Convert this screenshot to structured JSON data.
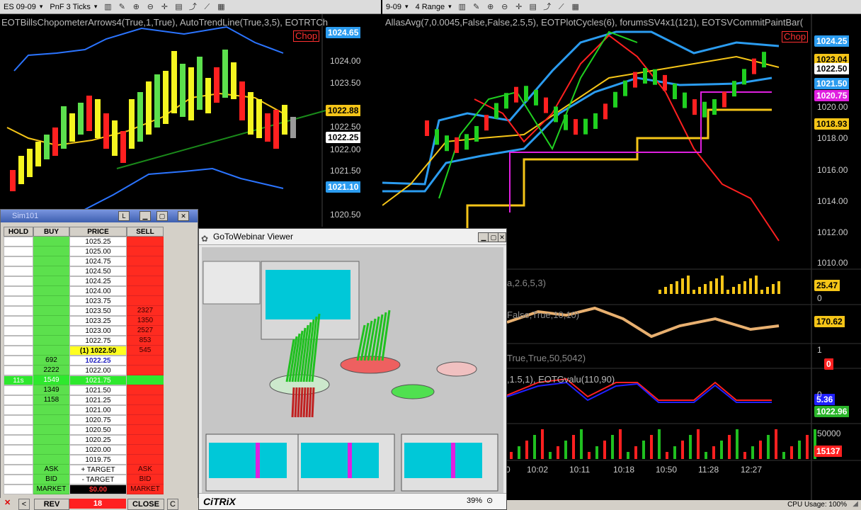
{
  "left_chart": {
    "toolbar": {
      "instrument": "ES 09-09",
      "bar_type": "PnF 3 Ticks"
    },
    "title": "EOTBillsChopometerArrows4(True,1,True), AutoTrendLine(True,3,5), EOTRTCh",
    "chop": "Chop",
    "axis_labels": [
      "1024.00",
      "1023.50",
      "1022.50",
      "1022.00",
      "1021.50",
      "1020.50"
    ],
    "tags": [
      {
        "text": "1024.65",
        "color": "#2b9cf0"
      },
      {
        "text": "1022.88",
        "color": "#f5c518"
      },
      {
        "text": "1022.25",
        "color": "#ffffff"
      },
      {
        "text": "1021.10",
        "color": "#2b9cf0"
      }
    ]
  },
  "right_chart": {
    "toolbar": {
      "instrument": "9-09",
      "bar_type": "4 Range"
    },
    "title": "AllasAvg(7,0.0045,False,False,2.5,5), EOTPlotCycles(6), forumsSV4x1(121), EOTSVCommitPaintBar(",
    "chop": "Chop",
    "axis_labels": [
      "1020.00",
      "1018.00",
      "1016.00",
      "1014.00",
      "1012.00",
      "1010.00"
    ],
    "tags": [
      {
        "text": "1024.25",
        "color": "#2b9cf0"
      },
      {
        "text": "1023.04",
        "color": "#f5c518"
      },
      {
        "text": "1022.50",
        "color": "#ffffff"
      },
      {
        "text": "1021.50",
        "color": "#2b9cf0"
      },
      {
        "text": "1020.75",
        "color": "#e020e0"
      },
      {
        "text": "1018.93",
        "color": "#f5c518"
      }
    ],
    "panels": [
      {
        "title": "a,2.6,5,3)",
        "tag": "25.47",
        "tag_color": "#f5c518",
        "axis": "0"
      },
      {
        "title": "False,True,10,10)",
        "tag": "170.62",
        "tag_color": "#f5c518",
        "axis": ""
      },
      {
        "title": "True,True,50,5042)",
        "tag": "0",
        "tag_color": "#ff2020",
        "axis": "1"
      },
      {
        "title": ",1.5,1), EOTGvalu(110,90)",
        "tag": "5.36",
        "tag_color": "#2020ff",
        "tag2": "1022.96",
        "tag2_color": "#2ab52a",
        "axis": "0"
      },
      {
        "title": "",
        "tag": "15137",
        "tag_color": "#ff2020",
        "axis": "50000"
      }
    ],
    "time_labels": [
      "0",
      "10:02",
      "10:11",
      "10:18",
      "10:50",
      "11:28",
      "12:27"
    ]
  },
  "dom": {
    "title": "Sim101",
    "headers": [
      "HOLD",
      "BUY",
      "PRICE",
      "SELL"
    ],
    "rows": [
      {
        "hold": "",
        "buy": "",
        "price": "1025.25",
        "sell": ""
      },
      {
        "hold": "",
        "buy": "",
        "price": "1025.00",
        "sell": ""
      },
      {
        "hold": "",
        "buy": "",
        "price": "1024.75",
        "sell": ""
      },
      {
        "hold": "",
        "buy": "",
        "price": "1024.50",
        "sell": ""
      },
      {
        "hold": "",
        "buy": "",
        "price": "1024.25",
        "sell": ""
      },
      {
        "hold": "",
        "buy": "",
        "price": "1024.00",
        "sell": ""
      },
      {
        "hold": "",
        "buy": "",
        "price": "1023.75",
        "sell": ""
      },
      {
        "hold": "",
        "buy": "",
        "price": "1023.50",
        "sell": "2327"
      },
      {
        "hold": "",
        "buy": "",
        "price": "1023.25",
        "sell": "1350"
      },
      {
        "hold": "",
        "buy": "",
        "price": "1023.00",
        "sell": "2527"
      },
      {
        "hold": "",
        "buy": "",
        "price": "1022.75",
        "sell": "853"
      },
      {
        "hold": "",
        "buy": "",
        "price": "(1) 1022.50",
        "sell": "545"
      },
      {
        "hold": "",
        "buy": "692",
        "price": "1022.25",
        "sell": ""
      },
      {
        "hold": "",
        "buy": "2222",
        "price": "1022.00",
        "sell": ""
      },
      {
        "hold": "11s",
        "buy": "1549",
        "price": "1021.75",
        "sell": ""
      },
      {
        "hold": "",
        "buy": "1349",
        "price": "1021.50",
        "sell": ""
      },
      {
        "hold": "",
        "buy": "1158",
        "price": "1021.25",
        "sell": ""
      },
      {
        "hold": "",
        "buy": "",
        "price": "1021.00",
        "sell": ""
      },
      {
        "hold": "",
        "buy": "",
        "price": "1020.75",
        "sell": ""
      },
      {
        "hold": "",
        "buy": "",
        "price": "1020.50",
        "sell": ""
      },
      {
        "hold": "",
        "buy": "",
        "price": "1020.25",
        "sell": ""
      },
      {
        "hold": "",
        "buy": "",
        "price": "1020.00",
        "sell": ""
      },
      {
        "hold": "",
        "buy": "",
        "price": "1019.75",
        "sell": ""
      }
    ],
    "order_rows": [
      {
        "buy": "ASK",
        "price": "+ TARGET",
        "sell": "ASK"
      },
      {
        "buy": "BID",
        "price": "- TARGET",
        "sell": "BID"
      },
      {
        "buy": "MARKET",
        "price": "$0.00",
        "sell": "MARKET"
      }
    ],
    "bottom": {
      "left": "<",
      "rev": "REV",
      "qty": "18",
      "close": "CLOSE",
      "right": "C"
    }
  },
  "gtw": {
    "title": "GoToWebinar Viewer",
    "logo": "CiTRiX",
    "zoom": "39%"
  },
  "status": {
    "cpu": "CPU Usage: 100%"
  }
}
